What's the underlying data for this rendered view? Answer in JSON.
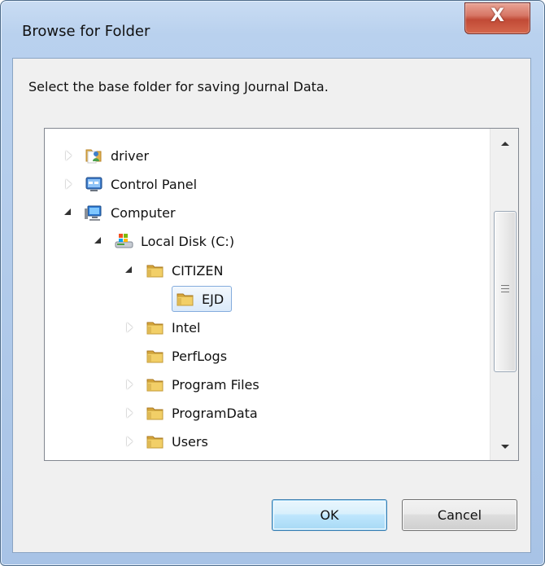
{
  "window": {
    "title": "Browse for Folder",
    "close_glyph": "X"
  },
  "dialog": {
    "instruction": "Select the base folder for saving Journal Data.",
    "buttons": {
      "ok": "OK",
      "cancel": "Cancel"
    }
  },
  "tree": {
    "items": [
      {
        "label": "driver",
        "icon": "user-folder-icon",
        "expander": "collapsed"
      },
      {
        "label": "Control Panel",
        "icon": "control-panel-icon",
        "expander": "collapsed"
      },
      {
        "label": "Computer",
        "icon": "computer-icon",
        "expander": "expanded"
      },
      {
        "label": "Local Disk (C:)",
        "icon": "local-disk-icon",
        "expander": "expanded"
      },
      {
        "label": "CITIZEN",
        "icon": "folder-icon",
        "expander": "expanded"
      },
      {
        "label": "EJD",
        "icon": "folder-icon",
        "expander": "none",
        "selected": true
      },
      {
        "label": "Intel",
        "icon": "folder-icon",
        "expander": "collapsed"
      },
      {
        "label": "PerfLogs",
        "icon": "folder-icon",
        "expander": "none"
      },
      {
        "label": "Program Files",
        "icon": "folder-icon",
        "expander": "collapsed"
      },
      {
        "label": "ProgramData",
        "icon": "folder-icon",
        "expander": "collapsed"
      },
      {
        "label": "Users",
        "icon": "folder-icon",
        "expander": "collapsed"
      }
    ]
  },
  "colors": {
    "window_frame": "#b9d1ee",
    "dialog_background": "#f0f0f0",
    "close_button": "#c14a36",
    "selection_border": "#84acdd",
    "selection_fill": "#dbeafa",
    "ok_button_border": "#3c7fb1"
  }
}
